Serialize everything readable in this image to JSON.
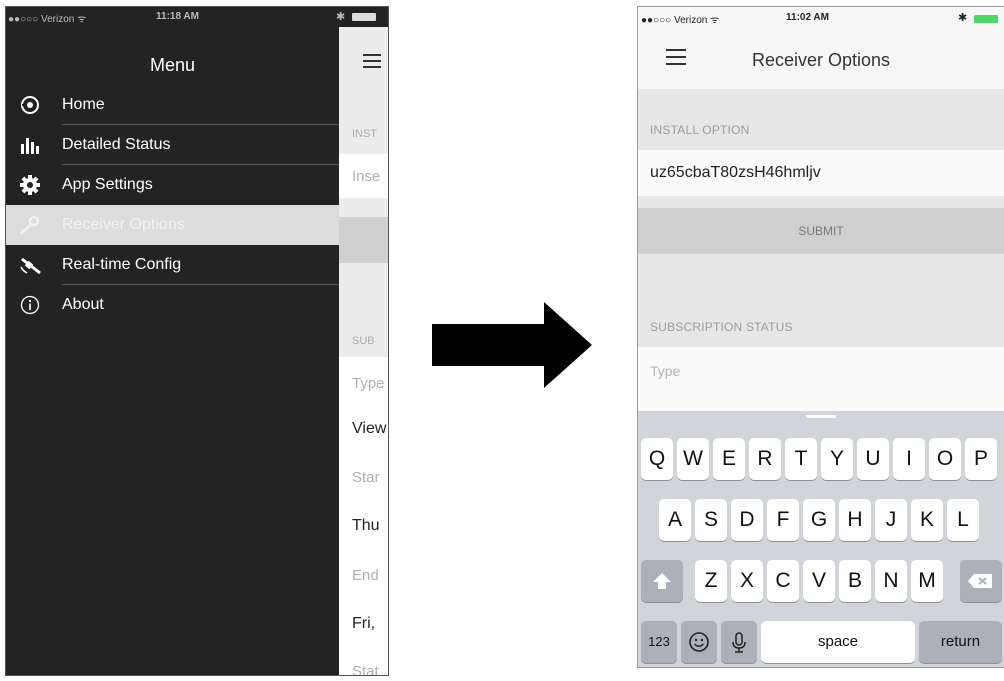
{
  "left": {
    "status": {
      "carrier": "●●○○○ Verizon ᯤ",
      "time": "11:18 AM",
      "bluetooth": "✱"
    },
    "drawer_title": "Menu",
    "menu_items": [
      {
        "label": "Home",
        "icon": "home-icon"
      },
      {
        "label": "Detailed Status",
        "icon": "bar-chart-icon"
      },
      {
        "label": "App Settings",
        "icon": "gear-icon"
      },
      {
        "label": "Receiver Options",
        "icon": "wrench-icon",
        "active": true
      },
      {
        "label": "Real-time Config",
        "icon": "satellite-icon"
      },
      {
        "label": "About",
        "icon": "info-icon"
      }
    ],
    "behind": {
      "install_label": "INST",
      "install_placeholder": "Inse",
      "subscription_label": "SUB",
      "type": "Type",
      "view": "View",
      "start": "Star",
      "thu": "Thu",
      "end": "End",
      "fri": "Fri,",
      "stat": "Stat"
    }
  },
  "right": {
    "status": {
      "carrier": "●●○○○ Verizon ᯤ",
      "time": "11:02 AM",
      "bluetooth": "✱"
    },
    "nav_title": "Receiver Options",
    "install_label": "INSTALL OPTION",
    "install_value": "uz65cbaT80zsH46hmljv",
    "submit_label": "SUBMIT",
    "subscription_label": "SUBSCRIPTION STATUS",
    "type_placeholder": "Type",
    "keyboard": {
      "row1": [
        "Q",
        "W",
        "E",
        "R",
        "T",
        "Y",
        "U",
        "I",
        "O",
        "P"
      ],
      "row2": [
        "A",
        "S",
        "D",
        "F",
        "G",
        "H",
        "J",
        "K",
        "L"
      ],
      "row3": [
        "Z",
        "X",
        "C",
        "V",
        "B",
        "N",
        "M"
      ],
      "numbers_label": "123",
      "space_label": "space",
      "return_label": "return"
    }
  },
  "colors": {
    "drawer_bg": "#232323",
    "active_item_bg": "#dcdcdc",
    "keyboard_bg": "#d1d4d9",
    "submit_bg": "#cfcfcf",
    "battery_green": "#4cd964"
  }
}
